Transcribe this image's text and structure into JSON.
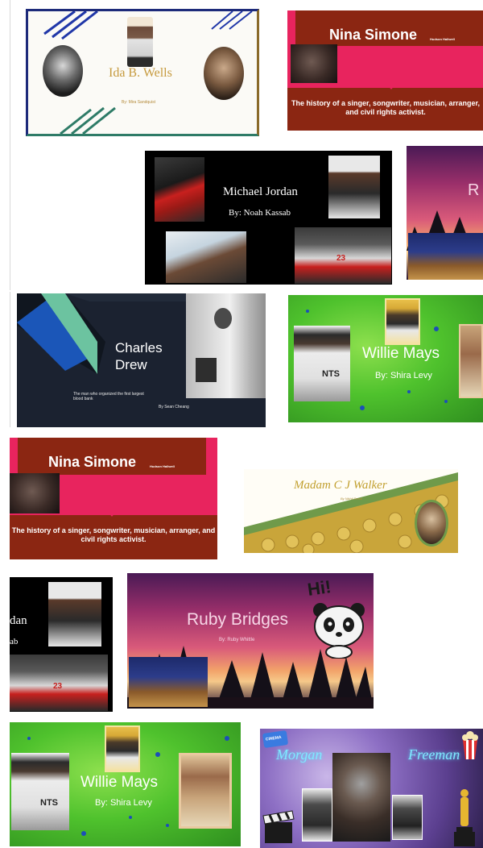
{
  "cards": {
    "ida": {
      "title": "Ida B. Wells",
      "byline": "By: Mira Sandquist"
    },
    "nina": {
      "title": "Nina Simone",
      "tag": "Hudson Hallwell",
      "description": "The history of a singer, songwriter, musician, arranger, and civil rights activist."
    },
    "jordan": {
      "title": "Michael Jordan",
      "byline": "By: Noah Kassab",
      "partial_title": "dan",
      "partial_byline": "ab",
      "jersey": "23"
    },
    "ruby_partial": {
      "title_fragment": "R"
    },
    "drew": {
      "title_line1": "Charles",
      "title_line2": "Drew",
      "subtitle": "The man who organized the first largest blood bank",
      "byline": "By Sean Cheang"
    },
    "mays": {
      "title": "Willie Mays",
      "byline": "By: Shira Levy",
      "cap_text": "NTS"
    },
    "walker": {
      "title": "Madam C J Walker",
      "byline": "By Nikhil Desai"
    },
    "ruby": {
      "title": "Ruby Bridges",
      "byline": "By: Ruby Whittle",
      "hi": "Hi!"
    },
    "freeman": {
      "title_left": "Morgan",
      "title_right": "Freeman",
      "sticker": "CINEMA"
    }
  },
  "colors": {
    "nina_red": "#8b2612",
    "nina_pink": "#e8245e",
    "drew_navy": "#1b2230",
    "drew_teal": "#6cc3a0",
    "walker_green": "#6f9a4a",
    "walker_gold": "#c9a53a"
  },
  "icons": [
    "panda-icon",
    "clapperboard-icon",
    "oscar-statue-icon",
    "popcorn-icon",
    "cinema-ticket-icon"
  ]
}
